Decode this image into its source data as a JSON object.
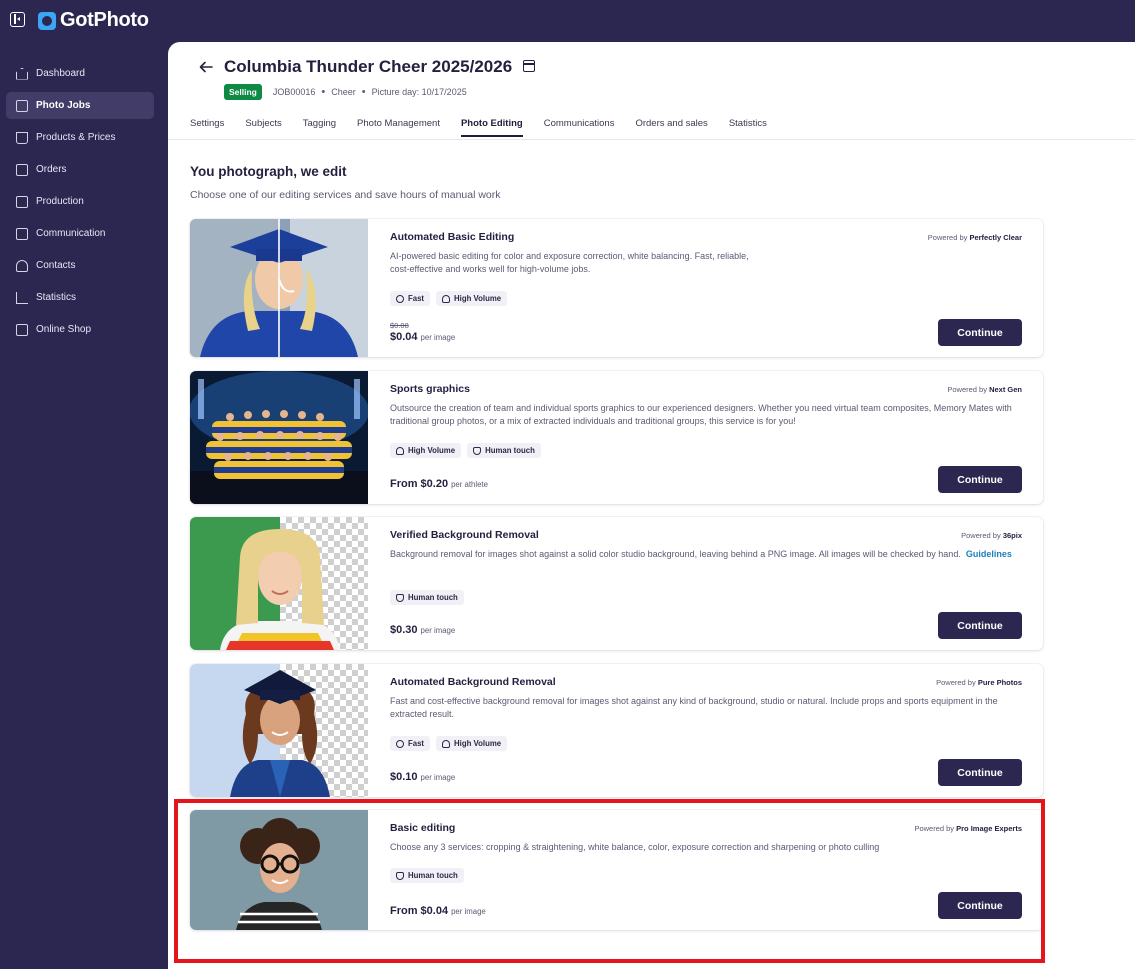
{
  "app": {
    "name": "GotPhoto"
  },
  "sidebar": {
    "items": [
      {
        "label": "Dashboard",
        "icon": "home-icon",
        "active": false
      },
      {
        "label": "Photo Jobs",
        "icon": "image-icon",
        "active": true
      },
      {
        "label": "Products & Prices",
        "icon": "cart-icon",
        "active": false
      },
      {
        "label": "Orders",
        "icon": "box-icon",
        "active": false
      },
      {
        "label": "Production",
        "icon": "printer-icon",
        "active": false
      },
      {
        "label": "Communication",
        "icon": "message-icon",
        "active": false
      },
      {
        "label": "Contacts",
        "icon": "user-icon",
        "active": false
      },
      {
        "label": "Statistics",
        "icon": "chart-icon",
        "active": false
      },
      {
        "label": "Online Shop",
        "icon": "store-icon",
        "active": false
      }
    ]
  },
  "job": {
    "title": "Columbia Thunder Cheer 2025/2026",
    "status": "Selling",
    "job_id": "JOB00016",
    "category": "Cheer",
    "picture_day": "Picture day: 10/17/2025"
  },
  "tabs": [
    {
      "label": "Settings",
      "active": false
    },
    {
      "label": "Subjects",
      "active": false
    },
    {
      "label": "Tagging",
      "active": false
    },
    {
      "label": "Photo Management",
      "active": false
    },
    {
      "label": "Photo Editing",
      "active": true
    },
    {
      "label": "Communications",
      "active": false
    },
    {
      "label": "Orders and sales",
      "active": false
    },
    {
      "label": "Statistics",
      "active": false
    }
  ],
  "section": {
    "title": "You photograph, we edit",
    "subtitle": "Choose one of our editing services and save hours of manual work"
  },
  "services": [
    {
      "title": "Automated Basic Editing",
      "powered_label": "Powered by",
      "provider": "Perfectly Clear",
      "description": "AI-powered basic editing for color and exposure correction, white balancing. Fast, reliable, cost-effective and works well for high-volume jobs.",
      "link": "",
      "tags": [
        "Fast",
        "High Volume"
      ],
      "price_old": "$0.08",
      "price": "$0.04",
      "price_unit": "per image",
      "cta": "Continue"
    },
    {
      "title": "Sports graphics",
      "powered_label": "Powered by",
      "provider": "Next Gen",
      "description": "Outsource the creation of team and individual sports graphics to our experienced designers. Whether you need virtual team composites, Memory Mates with traditional group photos, or a mix of extracted individuals and traditional groups, this service is for you!",
      "link": "",
      "tags": [
        "High Volume",
        "Human touch"
      ],
      "price_old": "",
      "price": "From $0.20",
      "price_unit": "per athlete",
      "cta": "Continue"
    },
    {
      "title": "Verified Background Removal",
      "powered_label": "Powered by",
      "provider": "36pix",
      "description": "Background removal for images shot against a solid color studio background, leaving behind a PNG image. All images will be checked by hand.",
      "link": "Guidelines",
      "tags": [
        "Human touch"
      ],
      "price_old": "",
      "price": "$0.30",
      "price_unit": "per image",
      "cta": "Continue"
    },
    {
      "title": "Automated Background Removal",
      "powered_label": "Powered by",
      "provider": "Pure Photos",
      "description": "Fast and cost-effective background removal for images shot against any kind of background, studio or natural. Include props and sports equipment in the extracted result.",
      "link": "",
      "tags": [
        "Fast",
        "High Volume"
      ],
      "price_old": "",
      "price": "$0.10",
      "price_unit": "per image",
      "cta": "Continue"
    },
    {
      "title": "Basic editing",
      "powered_label": "Powered by",
      "provider": "Pro Image Experts",
      "description": "Choose any 3 services: cropping & straightening, white balance, color, exposure correction and sharpening or photo culling",
      "link": "",
      "tags": [
        "Human touch"
      ],
      "price_old": "",
      "price": "From $0.04",
      "price_unit": "per image",
      "cta": "Continue"
    }
  ],
  "colors": {
    "sidebar_bg": "#2b2750",
    "accent": "#2b2750",
    "selling_badge": "#0e8a45",
    "highlight": "#e4151b",
    "link": "#1d7fc0"
  }
}
